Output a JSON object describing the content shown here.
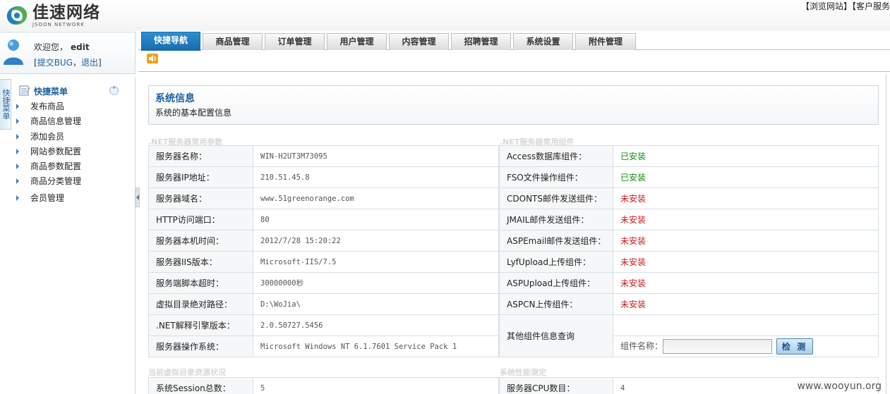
{
  "header": {
    "brand_cn": "佳速网络",
    "brand_en": "JSOON NETWORK",
    "toplinks": [
      "【浏览网站】",
      "【客户服务"
    ]
  },
  "user": {
    "welcome": "欢迎您，",
    "username": "edit",
    "links_prefix": "[",
    "submit_bug": "提交BUG",
    "sep": "，",
    "logout": "退出",
    "links_suffix": "]"
  },
  "tabs": [
    "快捷导航",
    "商品管理",
    "订单管理",
    "用户管理",
    "内容管理",
    "招聘管理",
    "系统设置",
    "附件管理"
  ],
  "side": {
    "vertical_tab": "快捷菜单",
    "menu_title": "快捷菜单",
    "collapse_glyph": "⌃",
    "items": [
      "发布商品",
      "商品信息管理",
      "添加会员",
      "网站参数配置",
      "商品参数配置",
      "商品分类管理",
      "会员管理"
    ]
  },
  "main": {
    "title": "系统信息",
    "subtitle": "系统的基本配置信息",
    "left_section": ".NET服务器常用参数",
    "right_section": ".NET服务器常用组件",
    "server_params": [
      {
        "label": "服务器名称：",
        "value": "WIN-H2UT3M73095"
      },
      {
        "label": "服务器IP地址：",
        "value": "210.51.45.8"
      },
      {
        "label": "服务器域名：",
        "value": "www.51greenorange.com"
      },
      {
        "label": "HTTP访问端口：",
        "value": "80"
      },
      {
        "label": "服务器本机时间：",
        "value": "2012/7/28 15:20:22"
      },
      {
        "label": "服务器IIS版本：",
        "value": "Microsoft-IIS/7.5"
      },
      {
        "label": "服务端脚本超时：",
        "value": "30000000秒"
      },
      {
        "label": "虚拟目录绝对路径：",
        "value": "D:\\WoJia\\"
      },
      {
        "label": ".NET解释引擎版本：",
        "value": "2.0.50727.5456"
      },
      {
        "label": "服务器操作系统：",
        "value": "Microsoft Windows NT 6.1.7601 Service Pack 1"
      }
    ],
    "components": [
      {
        "label": "Access数据库组件：",
        "status": "已安装",
        "installed": true
      },
      {
        "label": "FSO文件操作组件：",
        "status": "已安装",
        "installed": true
      },
      {
        "label": "CDONTS邮件发送组件：",
        "status": "未安装",
        "installed": false
      },
      {
        "label": "JMAIL邮件发送组件：",
        "status": "未安装",
        "installed": false
      },
      {
        "label": "ASPEmail邮件发送组件：",
        "status": "未安装",
        "installed": false
      },
      {
        "label": "LyfUpload上传组件：",
        "status": "未安装",
        "installed": false
      },
      {
        "label": "ASPUpload上传组件：",
        "status": "未安装",
        "installed": false
      },
      {
        "label": "ASPCN上传组件：",
        "status": "未安装",
        "installed": false
      }
    ],
    "other_query": {
      "label": "其他组件信息查询",
      "field_label": "组件名称：",
      "input_value": "",
      "button": "检 测"
    },
    "bottom_left_section": "当前虚拟目录资源状况",
    "bottom_right_section": "系统性能测定",
    "session_label": "系统Session总数：",
    "session_value": "5",
    "cpu_label": "服务器CPU数目：",
    "cpu_value": "4"
  },
  "colors": {
    "accent": "#1a6aab",
    "installed": "#1a8a1a",
    "not_installed": "#cc1a1a"
  },
  "watermark": "www.wooyun.org"
}
